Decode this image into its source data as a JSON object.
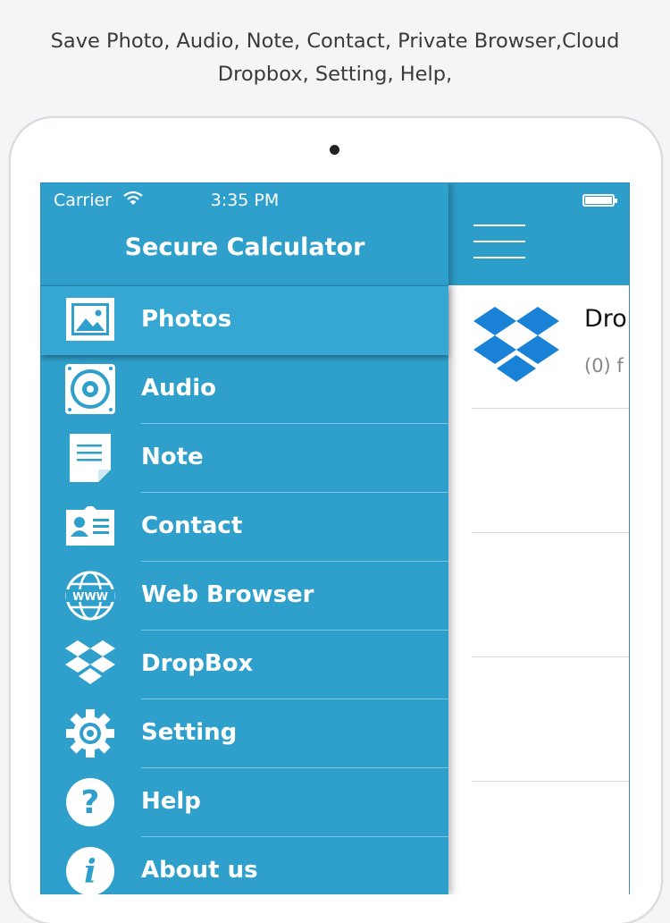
{
  "caption": {
    "line1": "Save Photo, Audio, Note, Contact, Private Browser,Cloud",
    "line2": "Dropbox, Setting, Help,"
  },
  "status_bar": {
    "carrier": "Carrier",
    "time": "3:35 PM"
  },
  "drawer": {
    "title": "Secure Calculator",
    "items": [
      {
        "label": "Photos",
        "icon": "photos-icon",
        "active": true
      },
      {
        "label": "Audio",
        "icon": "speaker-icon"
      },
      {
        "label": "Note",
        "icon": "note-icon"
      },
      {
        "label": "Contact",
        "icon": "contact-card-icon"
      },
      {
        "label": "Web Browser",
        "icon": "globe-icon"
      },
      {
        "label": "DropBox",
        "icon": "dropbox-icon"
      },
      {
        "label": "Setting",
        "icon": "gear-icon"
      },
      {
        "label": "Help",
        "icon": "question-icon"
      },
      {
        "label": "About us",
        "icon": "info-icon"
      }
    ]
  },
  "content": {
    "row": {
      "title": "Dro",
      "subtitle": "(0) f"
    }
  },
  "colors": {
    "accent": "#2f9fcb",
    "nav": "#2d9ec9",
    "active": "#35a7d2"
  }
}
